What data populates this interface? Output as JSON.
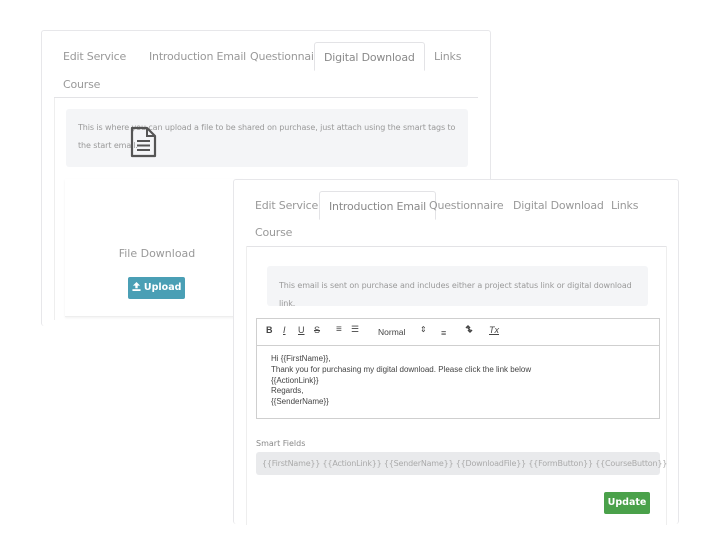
{
  "back_panel": {
    "tabs": [
      {
        "label": "Edit Service",
        "active": false
      },
      {
        "label": "Introduction Email",
        "active": false
      },
      {
        "label": "Questionnaire",
        "active": false
      },
      {
        "label": "Digital Download",
        "active": true
      },
      {
        "label": "Links",
        "active": false
      },
      {
        "label": "Course",
        "active": false
      }
    ],
    "info_text": "This is where you can upload a file to be shared on purchase, just attach using the smart tags to the start email.",
    "file_icon": "file-text-icon",
    "file_label": "File Download",
    "upload_icon": "upload-icon",
    "upload_label": "Upload"
  },
  "front_panel": {
    "tabs": [
      {
        "label": "Edit Service",
        "active": false
      },
      {
        "label": "Introduction Email",
        "active": true
      },
      {
        "label": "Questionnaire",
        "active": false
      },
      {
        "label": "Digital Download",
        "active": false
      },
      {
        "label": "Links",
        "active": false
      },
      {
        "label": "Course",
        "active": false
      }
    ],
    "info_text": "This email is sent on purchase and includes either a project status link or digital download link.",
    "toolbar": {
      "bold": "B",
      "italic": "I",
      "underline": "U",
      "strike": "S",
      "ordered_list": "≡",
      "bullet_list": "☰",
      "heading_select": "Normal",
      "align": "≡",
      "link": "🔗",
      "clean": "Tx"
    },
    "editor_lines": [
      "Hi {{FirstName}},",
      "Thank you for purchasing my digital download. Please click the link below",
      "{{ActionLink}}",
      "Regards,",
      "{{SenderName}}"
    ],
    "smart_fields_label": "Smart Fields",
    "smart_fields_value": "{{FirstName}} {{ActionLink}} {{SenderName}} {{DownloadFile}} {{FormButton}} {{CourseButton}}",
    "update_label": "Update"
  },
  "colors": {
    "upload_button": "#4a9fb5",
    "update_button": "#4aa14a",
    "info_bg": "#f4f5f7"
  }
}
